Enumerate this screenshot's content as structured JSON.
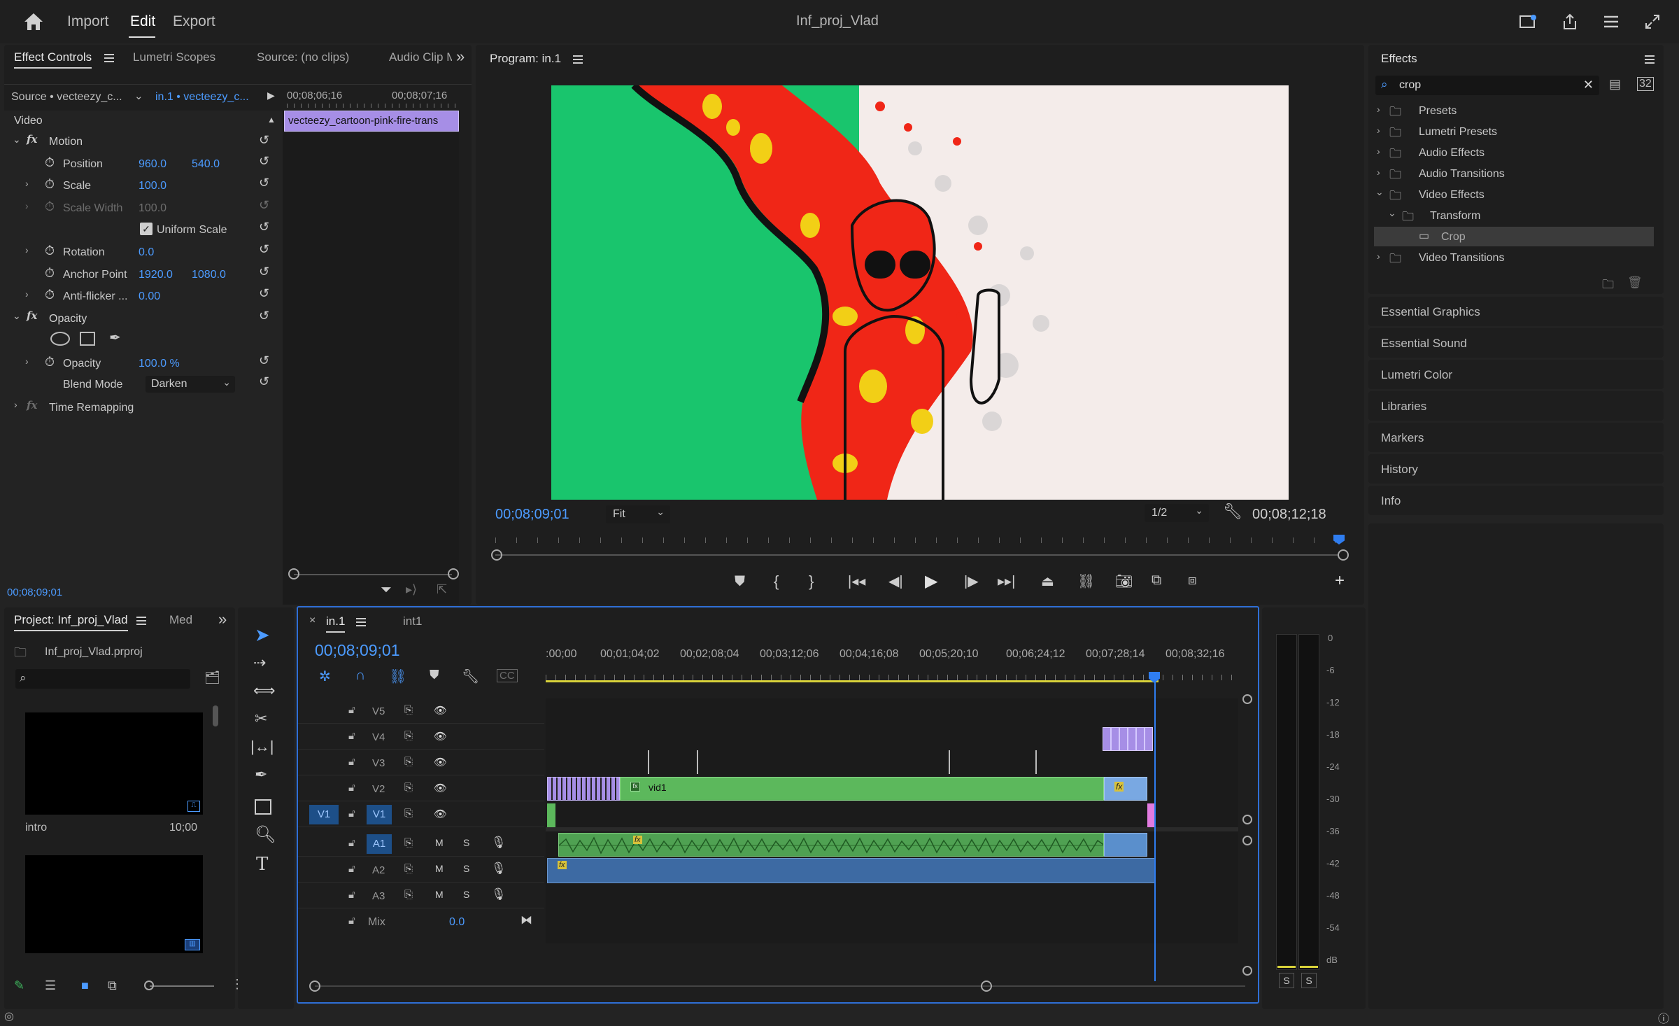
{
  "topbar": {
    "home_icon": "home-icon",
    "nav": [
      "Import",
      "Edit",
      "Export"
    ],
    "active": "Edit",
    "title": "Inf_proj_Vlad"
  },
  "effect_controls": {
    "tabs": [
      "Effect Controls",
      "Lumetri Scopes",
      "Source: (no clips)",
      "Audio Clip M"
    ],
    "source": "Source • vecteezy_c...",
    "sequence": "in.1 • vecteezy_c...",
    "time_a": "00;08;06;16",
    "time_b": "00;08;07;16",
    "clip_label": "vecteezy_cartoon-pink-fire-trans",
    "video_label": "Video",
    "motion": "Motion",
    "props": [
      {
        "name": "Position",
        "v1": "960.0",
        "v2": "540.0"
      },
      {
        "name": "Scale",
        "v1": "100.0",
        "v2": ""
      },
      {
        "name": "Scale Width",
        "v1": "100.0",
        "v2": ""
      },
      {
        "name": "Rotation",
        "v1": "0.0",
        "v2": ""
      },
      {
        "name": "Anchor Point",
        "v1": "1920.0",
        "v2": "1080.0"
      },
      {
        "name": "Anti-flicker ...",
        "v1": "0.00",
        "v2": ""
      }
    ],
    "uniform_scale": "Uniform Scale",
    "opacity_header": "Opacity",
    "opacity_label": "Opacity",
    "opacity_value": "100.0 %",
    "blend_label": "Blend Mode",
    "blend_value": "Darken",
    "time_remap": "Time Remapping",
    "timecode": "00;08;09;01"
  },
  "program": {
    "title": "Program: in.1",
    "timecode": "00;08;09;01",
    "fit": "Fit",
    "res": "1/2",
    "duration": "00;08;12;18"
  },
  "effects": {
    "title": "Effects",
    "search": "crop",
    "tree": [
      {
        "label": "Presets",
        "depth": 0
      },
      {
        "label": "Lumetri Presets",
        "depth": 0
      },
      {
        "label": "Audio Effects",
        "depth": 0
      },
      {
        "label": "Audio Transitions",
        "depth": 0
      },
      {
        "label": "Video Effects",
        "depth": 0
      },
      {
        "label": "Transform",
        "depth": 1
      },
      {
        "label": "Crop",
        "depth": 2
      },
      {
        "label": "Video Transitions",
        "depth": 0
      }
    ],
    "panels": [
      "Essential Graphics",
      "Essential Sound",
      "Lumetri Color",
      "Libraries",
      "Markers",
      "History",
      "Info"
    ]
  },
  "project": {
    "tabs": [
      "Project: Inf_proj_Vlad",
      "Med"
    ],
    "file": "Inf_proj_Vlad.prproj",
    "items": [
      {
        "name": "intro",
        "duration": "10;00"
      }
    ]
  },
  "timeline": {
    "tabs": [
      "in.1",
      "int1"
    ],
    "timecode": "00;08;09;01",
    "ruler": [
      ":00;00",
      "00;01;04;02",
      "00;02;08;04",
      "00;03;12;06",
      "00;04;16;08",
      "00;05;20;10",
      "00;06;24;12",
      "00;07;28;14",
      "00;08;32;16"
    ],
    "video_tracks": [
      "V5",
      "V4",
      "V3",
      "V2",
      "V1"
    ],
    "audio_tracks": [
      "A1",
      "A2",
      "A3"
    ],
    "source_patch": "V1",
    "mix_label": "Mix",
    "mix_value": "0.0",
    "clip_vid1": "vid1",
    "meter_scale": [
      "0",
      "-6",
      "-12",
      "-18",
      "-24",
      "-30",
      "-36",
      "-42",
      "-48",
      "-54",
      "dB"
    ],
    "solo_labels": [
      "S",
      "S"
    ]
  },
  "colors": {
    "accent": "#4c9bff",
    "video_clip": "#5cb85c",
    "purple_clip": "#a68ee6",
    "pink_clip": "#e27be0",
    "audio_clip": "#4fa152"
  }
}
